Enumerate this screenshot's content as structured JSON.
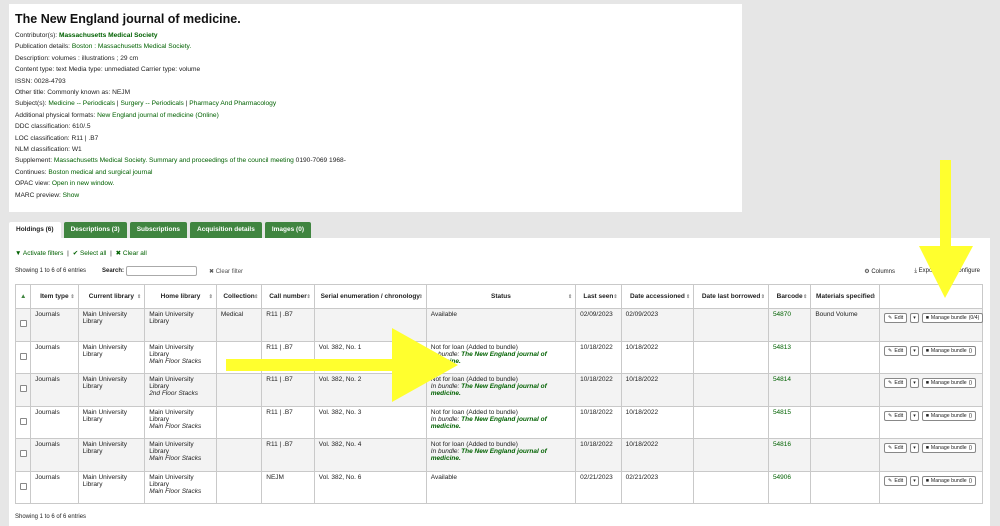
{
  "bib": {
    "title": "The New England journal of medicine.",
    "contributor": {
      "label": "Contributor(s):",
      "value": "Massachusetts Medical Society"
    },
    "publication": {
      "label": "Publication details:",
      "value": "Boston : Massachusetts Medical Society."
    },
    "description": {
      "label": "Description:",
      "value": "volumes : illustrations ; 29 cm"
    },
    "content": {
      "label1": "Content type:",
      "v1": "text",
      "label2": "Media type:",
      "v2": "unmediated",
      "label3": "Carrier type:",
      "v3": "volume"
    },
    "issn": {
      "label": "ISSN:",
      "value": "0028-4793"
    },
    "other_title": {
      "label": "Other title:",
      "value": "Commonly known as: NEJM"
    },
    "subjects": {
      "label": "Subject(s):",
      "items": [
        "Medicine -- Periodicals",
        "Surgery -- Periodicals",
        "Pharmacy And Pharmacology"
      ],
      "sep": " | "
    },
    "additional": {
      "label": "Additional physical formats:",
      "value": "New England journal of medicine (Online)"
    },
    "ddc": {
      "label": "DDC classification:",
      "value": "610/.5"
    },
    "loc": {
      "label": "LOC classification:",
      "value": "R11 | .B7"
    },
    "nlm": {
      "label": "NLM classification:",
      "value": "W1"
    },
    "supplement": {
      "label": "Supplement:",
      "link": "Massachusetts Medical Society. Summary and proceedings of the council meeting",
      "rest": "0190-7069 1968-"
    },
    "continues": {
      "label": "Continues:",
      "value": "Boston medical and surgical journal"
    },
    "opac": {
      "label": "OPAC view:",
      "value": "Open in new window."
    },
    "marc": {
      "label": "MARC preview:",
      "value": "Show"
    }
  },
  "tabs": [
    "Holdings (6)",
    "Descriptions (3)",
    "Subscriptions",
    "Acquisition details",
    "Images (0)"
  ],
  "toolbar": {
    "activate_filters": "Activate filters",
    "select_all": "Select all",
    "clear_all": "Clear all",
    "sep": "|",
    "showing": "Showing 1 to 6 of 6 entries",
    "search_label": "Search:",
    "search_value": "",
    "clear_filter": "Clear filter",
    "columns": "Columns",
    "export": "Export",
    "configure": "Configure"
  },
  "columns": [
    "Item type",
    "Current library",
    "Home library",
    "Collection",
    "Call number",
    "Serial enumeration / chronology",
    "Status",
    "Last seen",
    "Date accessioned",
    "Date last borrowed",
    "Barcode",
    "Materials specified"
  ],
  "buttons": {
    "edit": "Edit",
    "manage": "Manage bundle"
  },
  "rows": [
    {
      "type": "Journals",
      "cur": "Main University Library",
      "home": "Main University Library",
      "homeloc": "",
      "coll": "Medical",
      "call": "R11 | .B7",
      "enum": "",
      "status": "Available",
      "in_bundle": "",
      "bundle": "",
      "seen": "02/09/2023",
      "acc": "02/09/2023",
      "borrowed": "",
      "barcode": "54870",
      "materials": "Bound Volume",
      "manage_suffix": "(0/4)"
    },
    {
      "type": "Journals",
      "cur": "Main University Library",
      "home": "Main University Library",
      "homeloc": "Main Floor Stacks",
      "coll": "",
      "call": "R11 | .B7",
      "enum": "Vol. 382, No. 1",
      "status": "Not for loan (Added to bundle)",
      "in_bundle": "In bundle:",
      "bundle": "The New England journal of medicine.",
      "seen": "10/18/2022",
      "acc": "10/18/2022",
      "borrowed": "",
      "barcode": "54813",
      "materials": "",
      "manage_suffix": "()"
    },
    {
      "type": "Journals",
      "cur": "Main University Library",
      "home": "Main University Library",
      "homeloc": "2nd Floor Stacks",
      "coll": "",
      "call": "R11 | .B7",
      "enum": "Vol. 382, No. 2",
      "status": "Not for loan (Added to bundle)",
      "in_bundle": "In bundle:",
      "bundle": "The New England journal of medicine.",
      "seen": "10/18/2022",
      "acc": "10/18/2022",
      "borrowed": "",
      "barcode": "54814",
      "materials": "",
      "manage_suffix": "()"
    },
    {
      "type": "Journals",
      "cur": "Main University Library",
      "home": "Main University Library",
      "homeloc": "Main Floor Stacks",
      "coll": "",
      "call": "R11 | .B7",
      "enum": "Vol. 382, No. 3",
      "status": "Not for loan (Added to bundle)",
      "in_bundle": "In bundle:",
      "bundle": "The New England journal of medicine.",
      "seen": "10/18/2022",
      "acc": "10/18/2022",
      "borrowed": "",
      "barcode": "54815",
      "materials": "",
      "manage_suffix": "()"
    },
    {
      "type": "Journals",
      "cur": "Main University Library",
      "home": "Main University Library",
      "homeloc": "Main Floor Stacks",
      "coll": "",
      "call": "R11 | .B7",
      "enum": "Vol. 382, No. 4",
      "status": "Not for loan (Added to bundle)",
      "in_bundle": "In bundle:",
      "bundle": "The New England journal of medicine.",
      "seen": "10/18/2022",
      "acc": "10/18/2022",
      "borrowed": "",
      "barcode": "54816",
      "materials": "",
      "manage_suffix": "()"
    },
    {
      "type": "Journals",
      "cur": "Main University Library",
      "home": "Main University Library",
      "homeloc": "Main Floor Stacks",
      "coll": "",
      "call": "NEJM",
      "enum": "Vol. 382, No. 6",
      "status": "Available",
      "in_bundle": "",
      "bundle": "",
      "seen": "02/21/2023",
      "acc": "02/21/2023",
      "borrowed": "",
      "barcode": "54906",
      "materials": "",
      "manage_suffix": "()"
    }
  ],
  "footer": "Showing 1 to 6 of 6 entries",
  "colors": {
    "accent": "#408540",
    "link": "#006100",
    "arrow": "#ffff2e"
  }
}
